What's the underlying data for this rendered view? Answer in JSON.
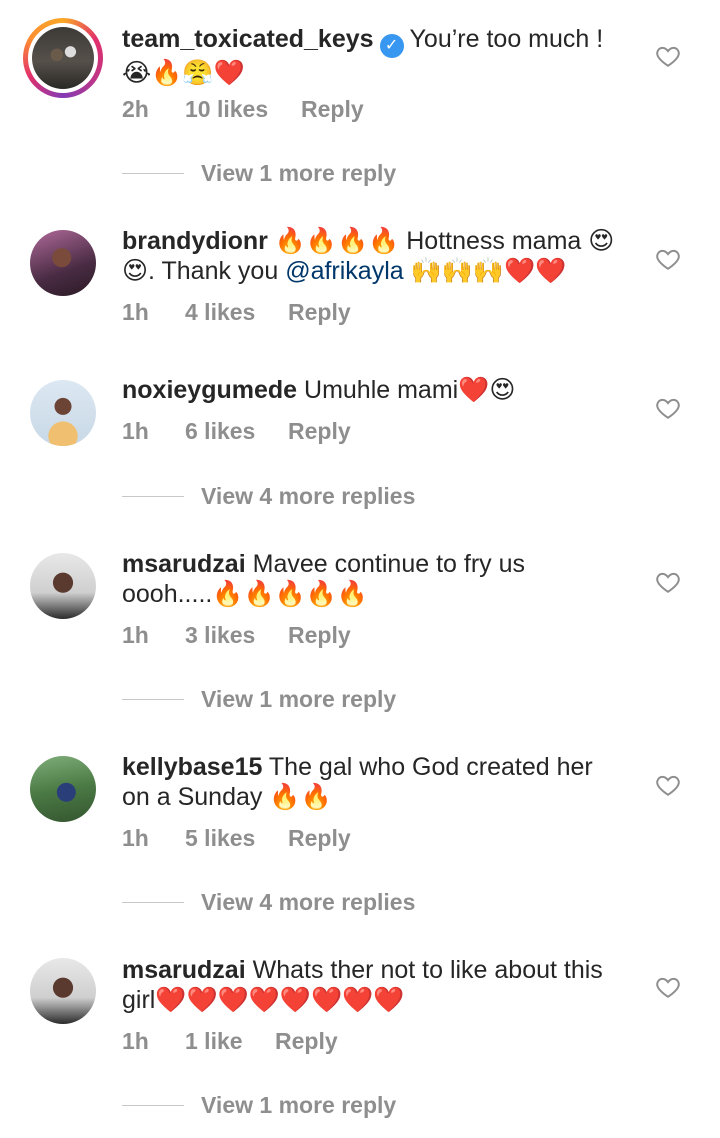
{
  "comments": [
    {
      "username": "team_toxicated_keys",
      "verified": true,
      "text_line1": "You’re too much !",
      "text_line2": "😭🔥😤❤️",
      "time": "2h",
      "likes": "10 likes",
      "reply": "Reply",
      "view_replies": "View 1 more reply",
      "avatar_icon": "avatar-story-ring"
    },
    {
      "username": "brandydionr",
      "text_line1": "🔥🔥🔥🔥 Hottness mama 😍",
      "text_line2_pre": "😍. Thank you ",
      "mention": "@afrikayla",
      "text_line2_post": " 🙌🙌🙌❤️❤️",
      "time": "1h",
      "likes": "4 likes",
      "reply": "Reply"
    },
    {
      "username": "noxieygumede",
      "text_line1": "Umuhle mami❤️😍",
      "time": "1h",
      "likes": "6 likes",
      "reply": "Reply",
      "view_replies": "View 4 more replies"
    },
    {
      "username": "msarudzai",
      "text_line1": "Mavee continue to fry us",
      "text_line2": "oooh.....🔥🔥🔥🔥🔥",
      "time": "1h",
      "likes": "3 likes",
      "reply": "Reply",
      "view_replies": "View 1 more reply"
    },
    {
      "username": "kellybase15",
      "text_line1": "The gal who God created her",
      "text_line2": "on a Sunday 🔥🔥",
      "time": "1h",
      "likes": "5 likes",
      "reply": "Reply",
      "view_replies": "View 4 more replies"
    },
    {
      "username": "msarudzai",
      "text_line1": "Whats ther not to like about this",
      "text_line2": "girl❤️❤️❤️❤️❤️❤️❤️❤️",
      "time": "1h",
      "likes": "1 like",
      "reply": "Reply",
      "view_replies": "View 1 more reply"
    }
  ],
  "colors": {
    "text": "#262626",
    "meta": "#8e8e8e",
    "mention": "#00376b",
    "verified": "#3897f0"
  }
}
